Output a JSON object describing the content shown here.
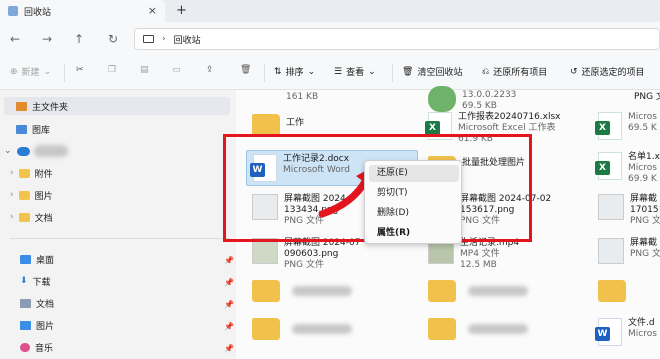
{
  "window": {
    "tab_title": "回收站",
    "close": "×",
    "new_tab": "+"
  },
  "nav": {
    "path": "回收站"
  },
  "toolbar": {
    "new": "新建",
    "sort": "排序",
    "view": "查看",
    "empty_bin": "清空回收站",
    "restore_all": "还原所有项目",
    "restore_selected": "还原选定的项目"
  },
  "sidebar": {
    "items": [
      "主文件夹",
      "图库",
      "附件",
      "图片",
      "文档",
      "桌面",
      "下载",
      "文档",
      "图片",
      "音乐"
    ]
  },
  "files": {
    "col1": [
      {
        "name": "161 KB",
        "sub": ""
      },
      {
        "name": "工作",
        "sub": ""
      },
      {
        "name": "工作记录2.docx",
        "sub": "Microsoft Word"
      },
      {
        "name": "屏幕截图 2024-",
        "sub": "133434.png",
        "sub2": "PNG 文件"
      },
      {
        "name": "屏幕截图 2024-07",
        "sub": "090603.png",
        "sub2": "PNG 文件"
      }
    ],
    "col2": [
      {
        "name": "13.0.0.2233",
        "sub": "69.5 KB"
      },
      {
        "name": "工作报表20240716.xlsx",
        "sub": "Microsoft Excel 工作表",
        "sub2": "61.9 KB"
      },
      {
        "name": "批量批处理图片",
        "sub": ""
      },
      {
        "name": "屏幕截图 2024-07-02",
        "sub": "153617.png",
        "sub2": "PNG 文件"
      },
      {
        "name": "生活记录.mp4",
        "sub": "MP4 文件",
        "sub2": "12.5 MB"
      }
    ],
    "col3": [
      {
        "name": "PNG 文件",
        "sub": ""
      },
      {
        "name": "Micros",
        "sub": "69.5 K"
      },
      {
        "name": "名单1.x",
        "sub": "Micros",
        "sub2": "69.9 K"
      },
      {
        "name": "屏幕截",
        "sub": "170151",
        "sub2": "PNG 文"
      },
      {
        "name": "屏幕截",
        "sub": "PNG 文"
      },
      {
        "name": "文件.d",
        "sub": "Micros"
      }
    ]
  },
  "context_menu": {
    "items": [
      "还原(E)",
      "剪切(T)",
      "删除(D)",
      "属性(R)"
    ]
  },
  "colors": {
    "accent": "#e3161d",
    "folder": "#f2c44e",
    "word": "#1f5fbf",
    "excel": "#1d7a45"
  }
}
